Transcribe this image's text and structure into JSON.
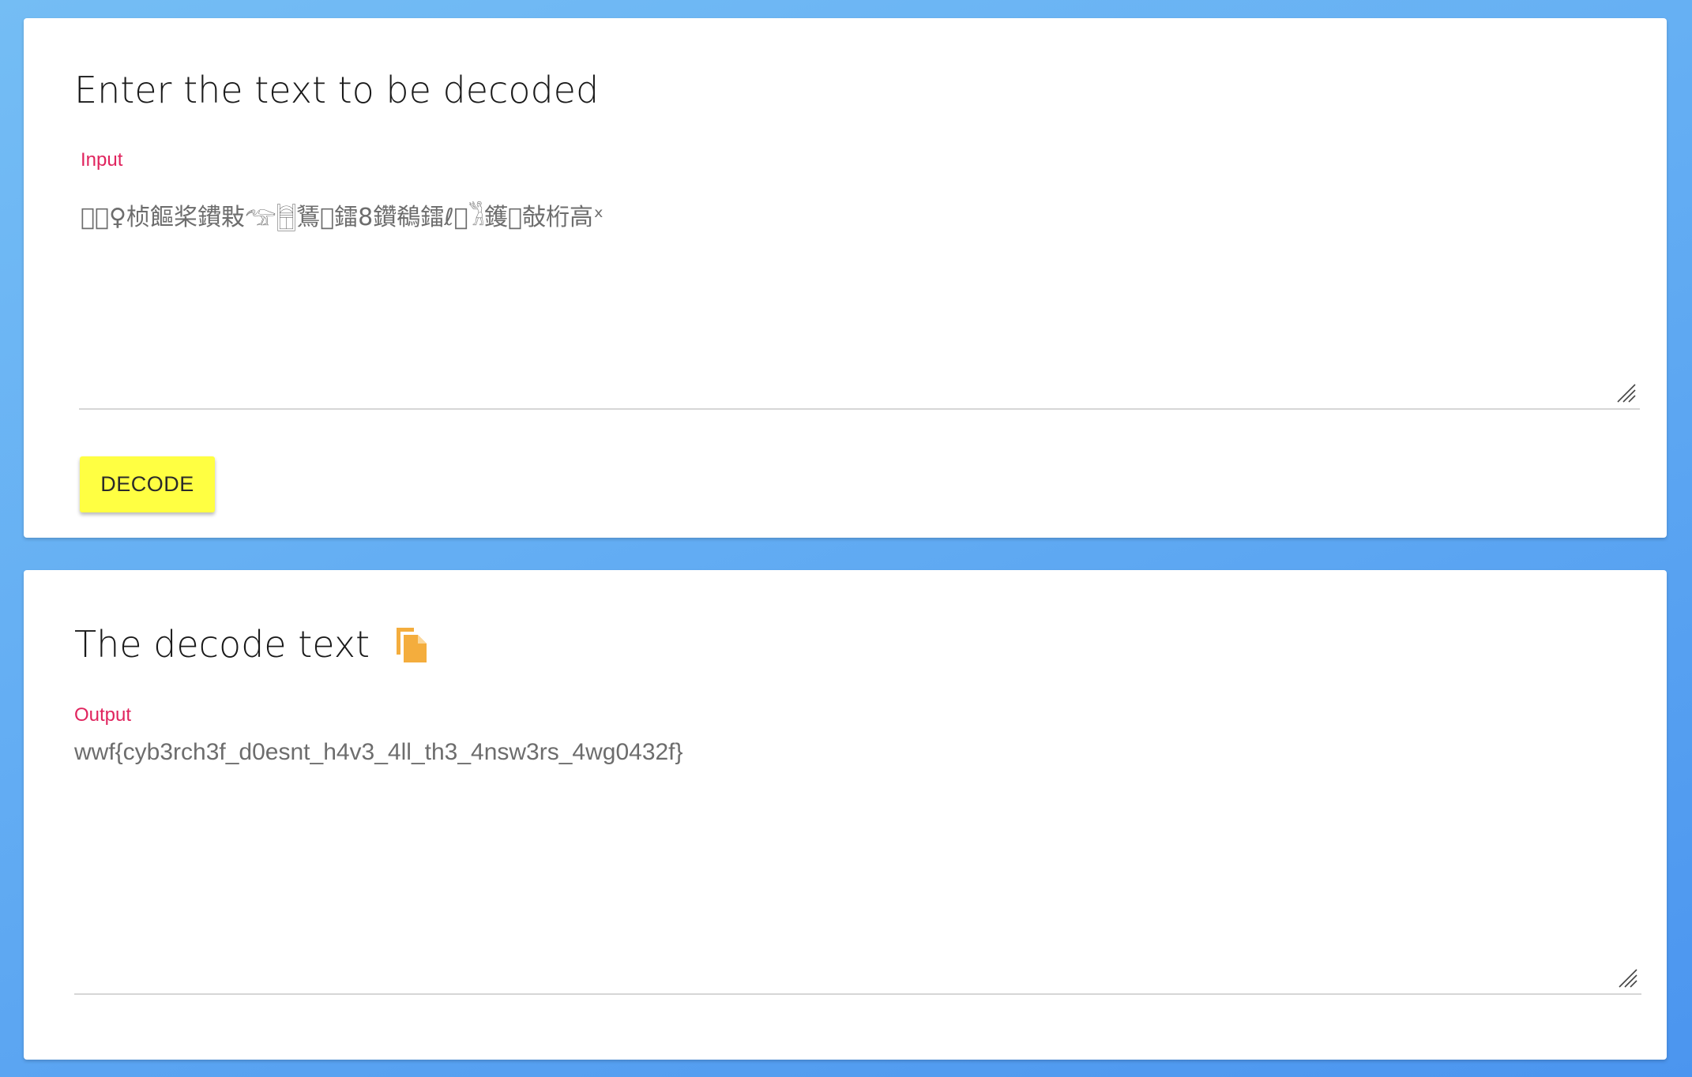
{
  "input_card": {
    "title": "Enter the text to be decoded",
    "field_label": "Input",
    "field_value": "\u0000\u0000♀桢饇桨鐨敤𓅠𓉰鵟\u0000鐳8鑽鵗鐳ℓ\u0000𓀢鑊\u0000敧桁高ˣ",
    "decode_button_label": "DECODE",
    "button_color": "#ffff42"
  },
  "output_card": {
    "title": "The decode text",
    "field_label": "Output",
    "field_value": "wwf{cyb3rch3f_d0esnt_h4v3_4ll_th3_4nsw3rs_4wg0432f}",
    "copy_icon": "copy-icon",
    "copy_icon_color": "#f4ad3d"
  },
  "colors": {
    "label_accent": "#e0245e",
    "background_gradient_start": "#74bdf4",
    "background_gradient_end": "#4b95ef"
  }
}
